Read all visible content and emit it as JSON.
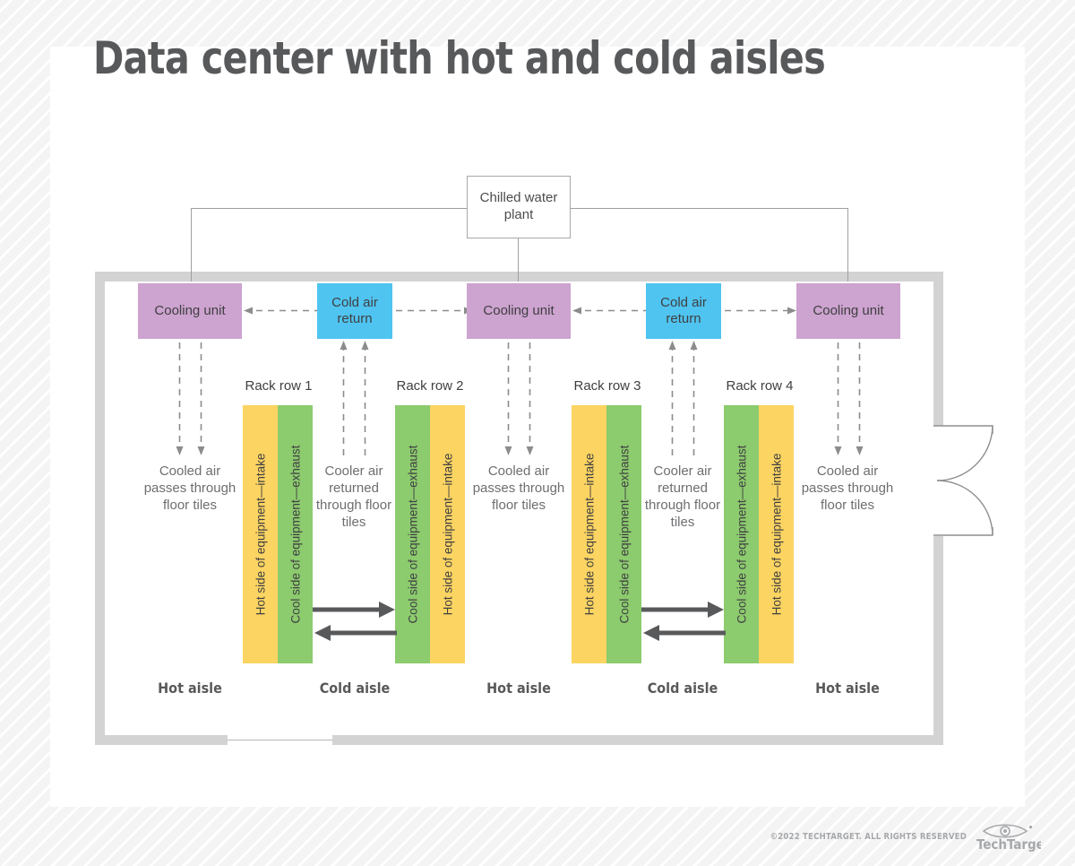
{
  "page": {
    "title": "Data center with hot and cold aisles",
    "background_color": "#f4f4f4",
    "card_color": "#ffffff"
  },
  "colors": {
    "title_text": "#58595b",
    "cooling_unit": "#cda3d0",
    "cold_air_return": "#4fc4f0",
    "rack_hot_side": "#fcd462",
    "rack_cool_side": "#8ccb6e",
    "wall": "#d3d3d4",
    "arrow": "#58595b",
    "dashed_arrow": "#8a8c8e",
    "caption_text": "#6d6e71"
  },
  "plant": {
    "label": "Chilled water plant"
  },
  "units": [
    {
      "id": "cooling-unit-1",
      "type": "cooling-unit",
      "label": "Cooling unit"
    },
    {
      "id": "cold-return-1",
      "type": "cold-air-return",
      "label": "Cold air return"
    },
    {
      "id": "cooling-unit-2",
      "type": "cooling-unit",
      "label": "Cooling unit"
    },
    {
      "id": "cold-return-2",
      "type": "cold-air-return",
      "label": "Cold air return"
    },
    {
      "id": "cooling-unit-3",
      "type": "cooling-unit",
      "label": "Cooling unit"
    }
  ],
  "rack_rows": [
    {
      "label": "Rack row 1",
      "columns": [
        {
          "side": "hot",
          "label": "Hot side of equipment—intake"
        },
        {
          "side": "cool",
          "label": "Cool side of equipment—exhaust"
        }
      ]
    },
    {
      "label": "Rack row 2",
      "columns": [
        {
          "side": "cool",
          "label": "Cool side of equipment—exhaust"
        },
        {
          "side": "hot",
          "label": "Hot side of equipment—intake"
        }
      ]
    },
    {
      "label": "Rack row 3",
      "columns": [
        {
          "side": "hot",
          "label": "Hot side of equipment—intake"
        },
        {
          "side": "cool",
          "label": "Cool side of equipment—exhaust"
        }
      ]
    },
    {
      "label": "Rack row 4",
      "columns": [
        {
          "side": "cool",
          "label": "Cool side of equipment—exhaust"
        },
        {
          "side": "hot",
          "label": "Hot side of equipment—intake"
        }
      ]
    }
  ],
  "flow_captions": [
    {
      "id": "caption-1",
      "text": "Cooled air passes through floor tiles",
      "direction": "down"
    },
    {
      "id": "caption-2",
      "text": "Cooler air returned through floor tiles",
      "direction": "up"
    },
    {
      "id": "caption-3",
      "text": "Cooled air passes through floor tiles",
      "direction": "down"
    },
    {
      "id": "caption-4",
      "text": "Cooler air returned through floor tiles",
      "direction": "up"
    },
    {
      "id": "caption-5",
      "text": "Cooled air passes through floor tiles",
      "direction": "down"
    }
  ],
  "aisle_labels": [
    {
      "id": "aisle-1",
      "text": "Hot aisle"
    },
    {
      "id": "aisle-2",
      "text": "Cold aisle"
    },
    {
      "id": "aisle-3",
      "text": "Hot aisle"
    },
    {
      "id": "aisle-4",
      "text": "Cold aisle"
    },
    {
      "id": "aisle-5",
      "text": "Hot aisle"
    }
  ],
  "footer": {
    "copyright": "©2022 TECHTARGET. ALL RIGHTS RESERVED",
    "logo_text": "TechTarget"
  }
}
